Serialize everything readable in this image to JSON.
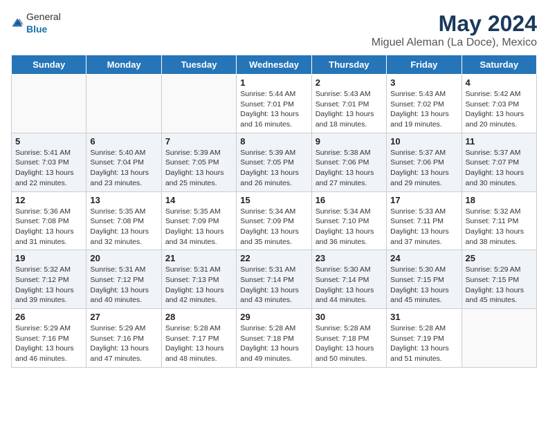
{
  "header": {
    "logo_general": "General",
    "logo_blue": "Blue",
    "main_title": "May 2024",
    "subtitle": "Miguel Aleman (La Doce), Mexico"
  },
  "days_of_week": [
    "Sunday",
    "Monday",
    "Tuesday",
    "Wednesday",
    "Thursday",
    "Friday",
    "Saturday"
  ],
  "weeks": [
    [
      {
        "day": "",
        "info": ""
      },
      {
        "day": "",
        "info": ""
      },
      {
        "day": "",
        "info": ""
      },
      {
        "day": "1",
        "info": "Sunrise: 5:44 AM\nSunset: 7:01 PM\nDaylight: 13 hours and 16 minutes."
      },
      {
        "day": "2",
        "info": "Sunrise: 5:43 AM\nSunset: 7:01 PM\nDaylight: 13 hours and 18 minutes."
      },
      {
        "day": "3",
        "info": "Sunrise: 5:43 AM\nSunset: 7:02 PM\nDaylight: 13 hours and 19 minutes."
      },
      {
        "day": "4",
        "info": "Sunrise: 5:42 AM\nSunset: 7:03 PM\nDaylight: 13 hours and 20 minutes."
      }
    ],
    [
      {
        "day": "5",
        "info": "Sunrise: 5:41 AM\nSunset: 7:03 PM\nDaylight: 13 hours and 22 minutes."
      },
      {
        "day": "6",
        "info": "Sunrise: 5:40 AM\nSunset: 7:04 PM\nDaylight: 13 hours and 23 minutes."
      },
      {
        "day": "7",
        "info": "Sunrise: 5:39 AM\nSunset: 7:05 PM\nDaylight: 13 hours and 25 minutes."
      },
      {
        "day": "8",
        "info": "Sunrise: 5:39 AM\nSunset: 7:05 PM\nDaylight: 13 hours and 26 minutes."
      },
      {
        "day": "9",
        "info": "Sunrise: 5:38 AM\nSunset: 7:06 PM\nDaylight: 13 hours and 27 minutes."
      },
      {
        "day": "10",
        "info": "Sunrise: 5:37 AM\nSunset: 7:06 PM\nDaylight: 13 hours and 29 minutes."
      },
      {
        "day": "11",
        "info": "Sunrise: 5:37 AM\nSunset: 7:07 PM\nDaylight: 13 hours and 30 minutes."
      }
    ],
    [
      {
        "day": "12",
        "info": "Sunrise: 5:36 AM\nSunset: 7:08 PM\nDaylight: 13 hours and 31 minutes."
      },
      {
        "day": "13",
        "info": "Sunrise: 5:35 AM\nSunset: 7:08 PM\nDaylight: 13 hours and 32 minutes."
      },
      {
        "day": "14",
        "info": "Sunrise: 5:35 AM\nSunset: 7:09 PM\nDaylight: 13 hours and 34 minutes."
      },
      {
        "day": "15",
        "info": "Sunrise: 5:34 AM\nSunset: 7:09 PM\nDaylight: 13 hours and 35 minutes."
      },
      {
        "day": "16",
        "info": "Sunrise: 5:34 AM\nSunset: 7:10 PM\nDaylight: 13 hours and 36 minutes."
      },
      {
        "day": "17",
        "info": "Sunrise: 5:33 AM\nSunset: 7:11 PM\nDaylight: 13 hours and 37 minutes."
      },
      {
        "day": "18",
        "info": "Sunrise: 5:32 AM\nSunset: 7:11 PM\nDaylight: 13 hours and 38 minutes."
      }
    ],
    [
      {
        "day": "19",
        "info": "Sunrise: 5:32 AM\nSunset: 7:12 PM\nDaylight: 13 hours and 39 minutes."
      },
      {
        "day": "20",
        "info": "Sunrise: 5:31 AM\nSunset: 7:12 PM\nDaylight: 13 hours and 40 minutes."
      },
      {
        "day": "21",
        "info": "Sunrise: 5:31 AM\nSunset: 7:13 PM\nDaylight: 13 hours and 42 minutes."
      },
      {
        "day": "22",
        "info": "Sunrise: 5:31 AM\nSunset: 7:14 PM\nDaylight: 13 hours and 43 minutes."
      },
      {
        "day": "23",
        "info": "Sunrise: 5:30 AM\nSunset: 7:14 PM\nDaylight: 13 hours and 44 minutes."
      },
      {
        "day": "24",
        "info": "Sunrise: 5:30 AM\nSunset: 7:15 PM\nDaylight: 13 hours and 45 minutes."
      },
      {
        "day": "25",
        "info": "Sunrise: 5:29 AM\nSunset: 7:15 PM\nDaylight: 13 hours and 45 minutes."
      }
    ],
    [
      {
        "day": "26",
        "info": "Sunrise: 5:29 AM\nSunset: 7:16 PM\nDaylight: 13 hours and 46 minutes."
      },
      {
        "day": "27",
        "info": "Sunrise: 5:29 AM\nSunset: 7:16 PM\nDaylight: 13 hours and 47 minutes."
      },
      {
        "day": "28",
        "info": "Sunrise: 5:28 AM\nSunset: 7:17 PM\nDaylight: 13 hours and 48 minutes."
      },
      {
        "day": "29",
        "info": "Sunrise: 5:28 AM\nSunset: 7:18 PM\nDaylight: 13 hours and 49 minutes."
      },
      {
        "day": "30",
        "info": "Sunrise: 5:28 AM\nSunset: 7:18 PM\nDaylight: 13 hours and 50 minutes."
      },
      {
        "day": "31",
        "info": "Sunrise: 5:28 AM\nSunset: 7:19 PM\nDaylight: 13 hours and 51 minutes."
      },
      {
        "day": "",
        "info": ""
      }
    ]
  ]
}
